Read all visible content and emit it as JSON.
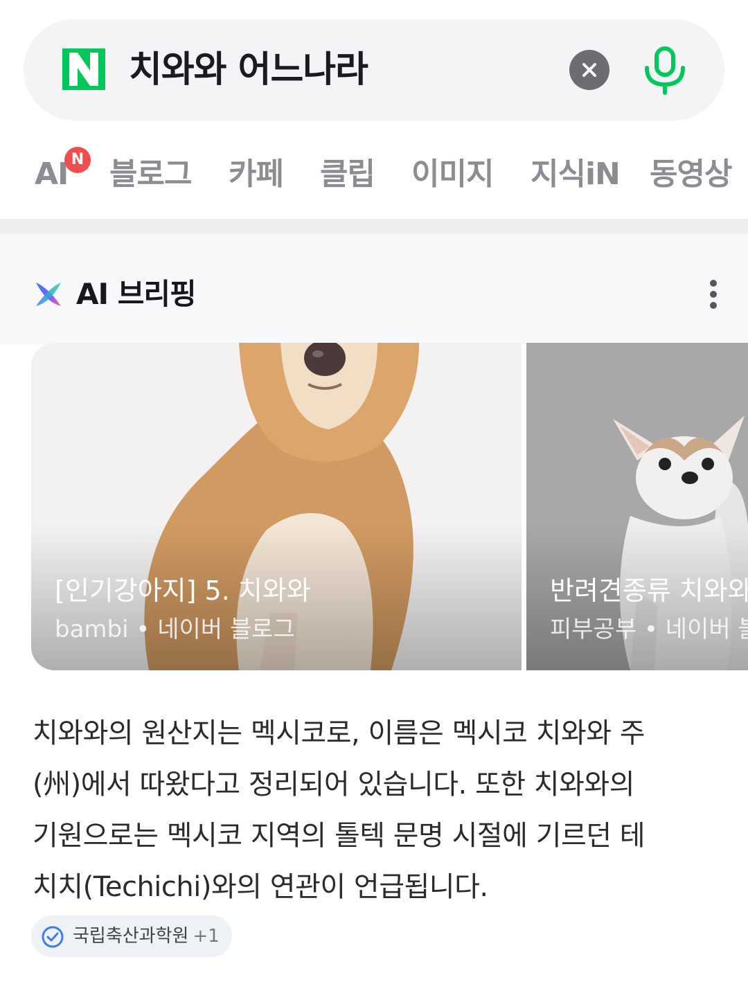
{
  "search": {
    "logo_letter": "N",
    "query": "치와와 어느나라",
    "brand_color": "#03c75a"
  },
  "tabs": {
    "ai": "AI",
    "ai_badge": "N",
    "items": [
      "블로그",
      "카페",
      "클립",
      "이미지",
      "지식iN",
      "동영상"
    ]
  },
  "briefing": {
    "title": "AI 브리핑",
    "cards": [
      {
        "title": "[인기강아지] 5. 치와와",
        "source": "bambi • 네이버 블로그"
      },
      {
        "title": "반려견종류 치와와",
        "source": "피부공부 • 네이버 블로그"
      }
    ],
    "summary_lines": [
      "치와와의 원산지는 멕시코로, 이름은 멕시코 치와와 주",
      "(州)에서 따왔다고 정리되어 있습니다. 또한 치와와의",
      "기원으로는 멕시코 지역의 톨텍 문명 시절에 기르던 테",
      "치치(Techichi)와의 연관이 언급됩니다."
    ],
    "source_chip": {
      "label": "국립축산과학원",
      "count": "+1"
    }
  }
}
